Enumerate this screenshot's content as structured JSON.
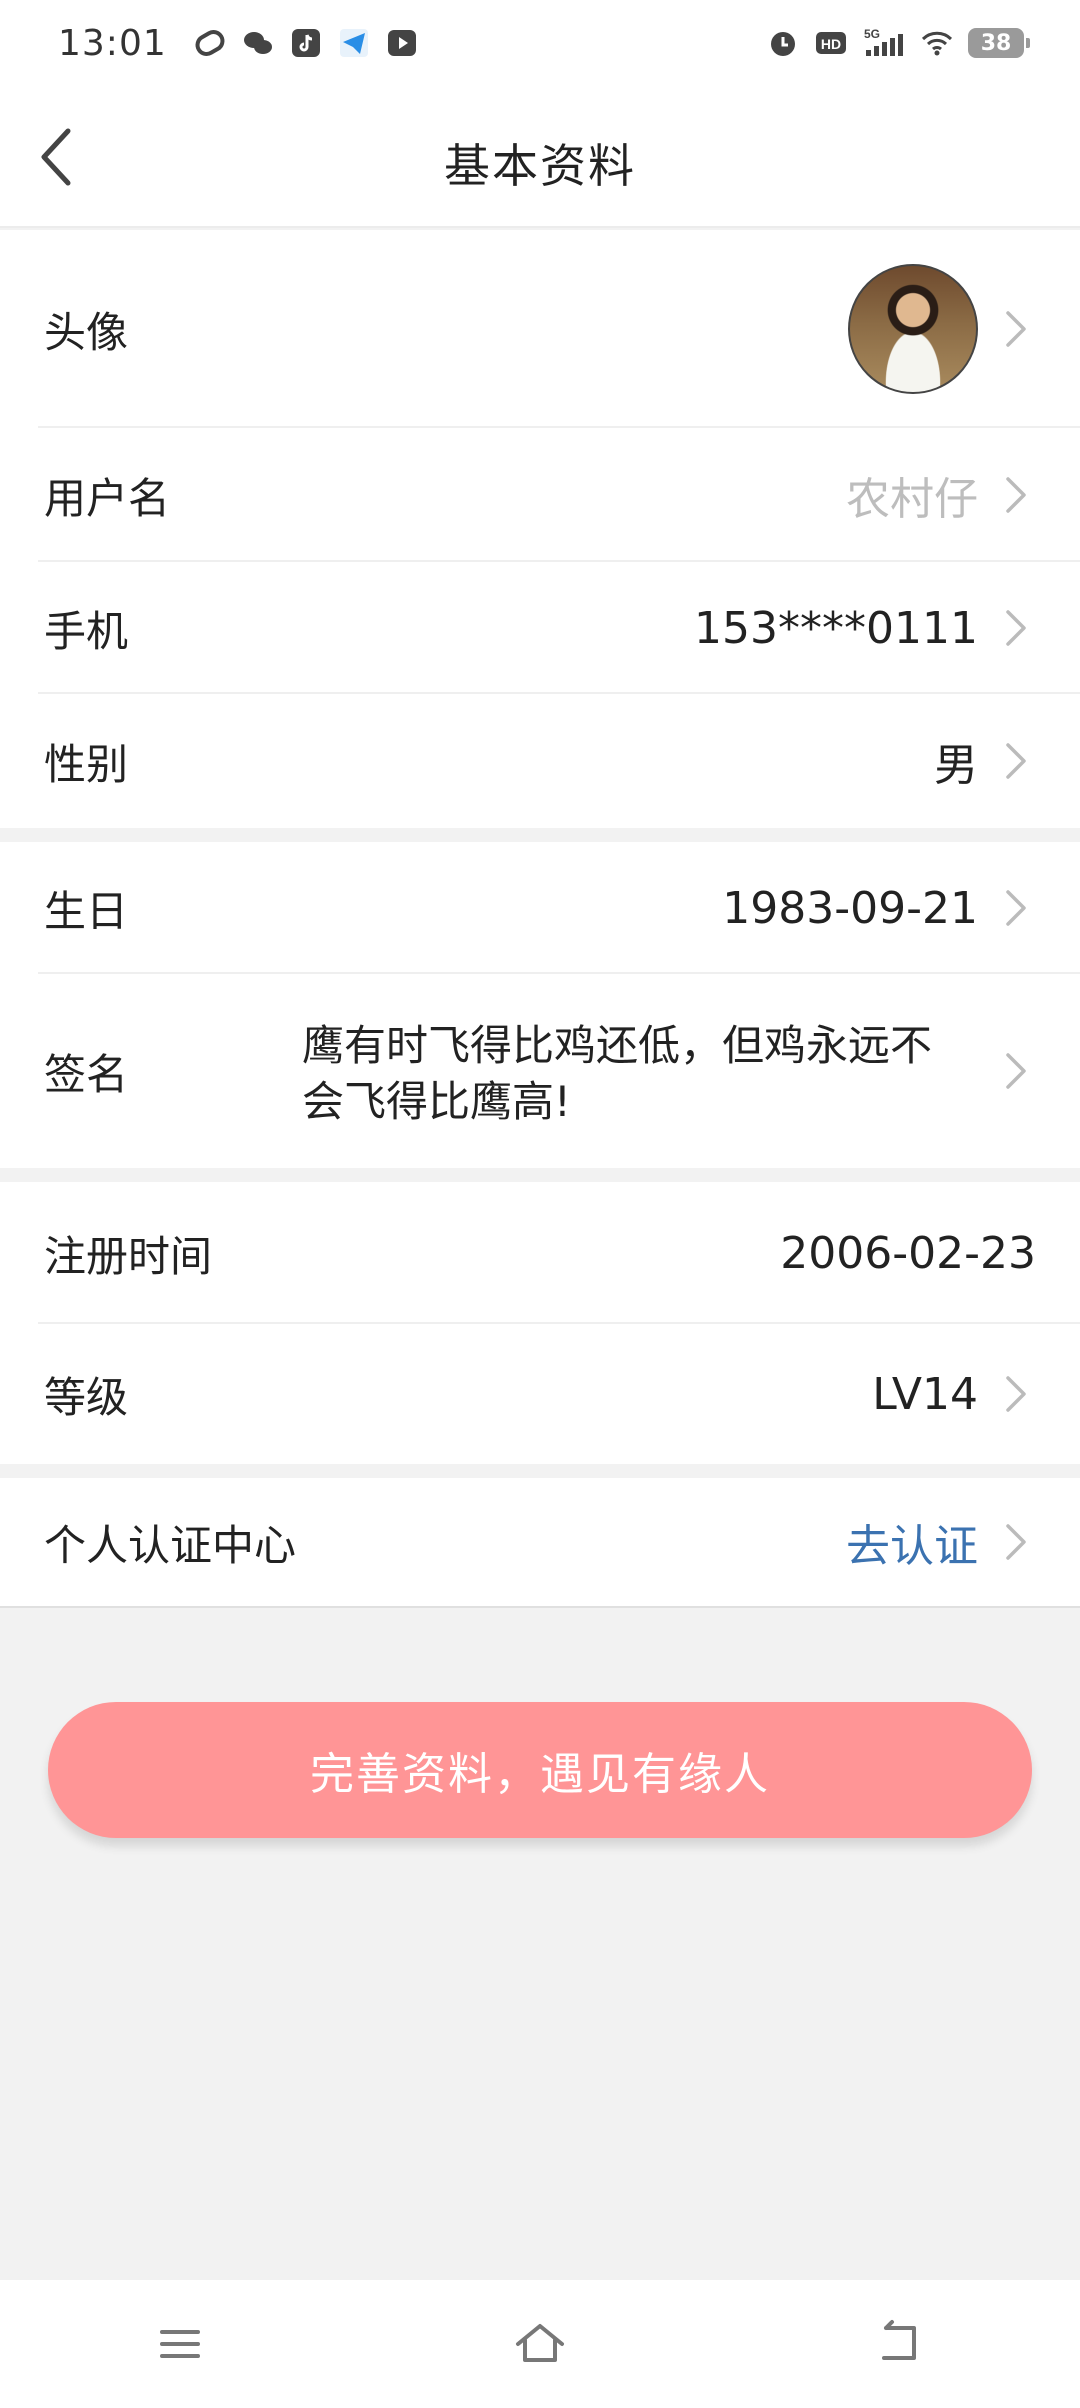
{
  "status_bar": {
    "time": "13:01",
    "battery": "38",
    "network": "5G"
  },
  "header": {
    "title": "基本资料"
  },
  "profile": {
    "avatar_label": "头像",
    "username_label": "用户名",
    "username_value": "农村仔",
    "phone_label": "手机",
    "phone_value": "153****0111",
    "gender_label": "性别",
    "gender_value": "男",
    "birthday_label": "生日",
    "birthday_value": "1983-09-21",
    "signature_label": "签名",
    "signature_value": "鹰有时飞得比鸡还低，但鸡永远不会飞得比鹰高!",
    "register_label": "注册时间",
    "register_value": "2006-02-23",
    "level_label": "等级",
    "level_value": "LV14",
    "verify_label": "个人认证中心",
    "verify_value": "去认证"
  },
  "cta": {
    "label": "完善资料，遇见有缘人"
  },
  "colors": {
    "accent": "#ff9596",
    "link": "#3b72b0",
    "muted": "#bdbdbd"
  },
  "icons": {
    "back": "chevron-left-icon",
    "chevron": "chevron-right-icon",
    "nav_menu": "menu-icon",
    "nav_home": "home-icon",
    "nav_back": "return-icon"
  }
}
